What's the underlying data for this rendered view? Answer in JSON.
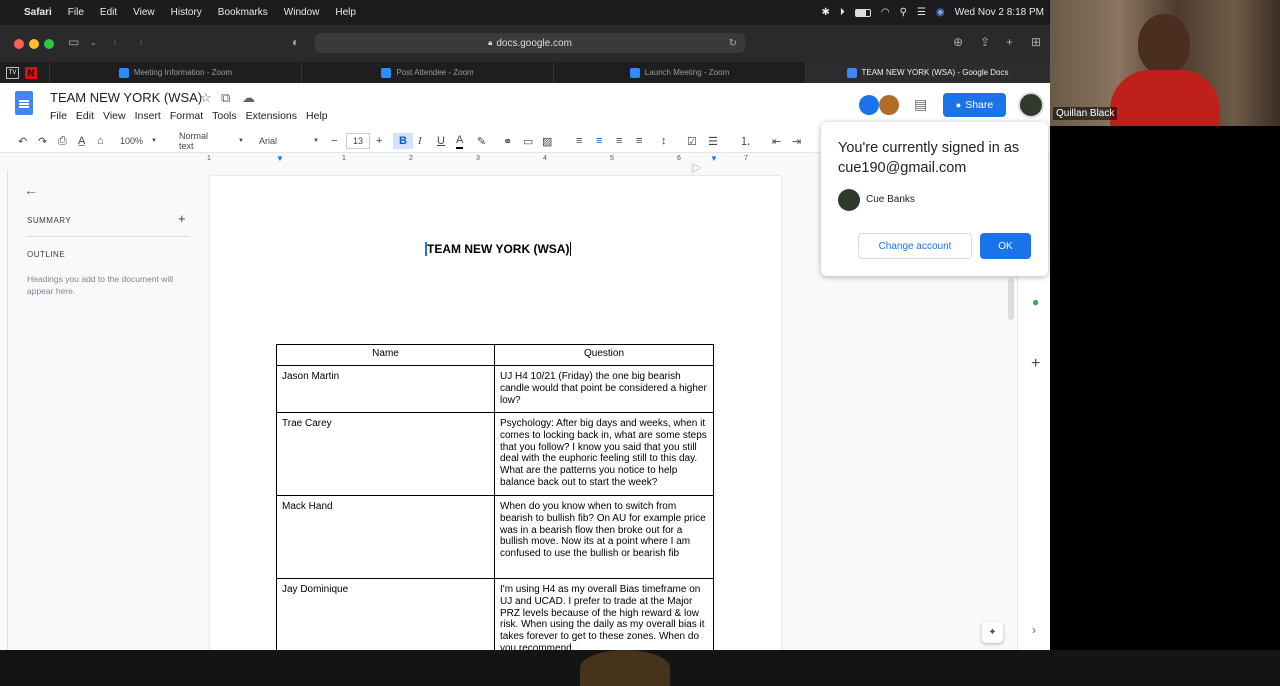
{
  "menubar": {
    "app_name": "Safari",
    "items": [
      "File",
      "Edit",
      "View",
      "History",
      "Bookmarks",
      "Window",
      "Help"
    ],
    "datetime": "Wed Nov 2  8:18 PM"
  },
  "safari": {
    "url": "docs.google.com",
    "tabs": [
      {
        "label": "Meeting Information - Zoom",
        "icon": "zoom-icon"
      },
      {
        "label": "Post Attendee - Zoom",
        "icon": "zoom-icon"
      },
      {
        "label": "Launch Meeting - Zoom",
        "icon": "zoom-icon"
      },
      {
        "label": "TEAM NEW YORK (WSA) - Google Docs",
        "icon": "google-docs-icon"
      }
    ]
  },
  "docs": {
    "title": "TEAM NEW YORK (WSA)",
    "menu": [
      "File",
      "Edit",
      "View",
      "Insert",
      "Format",
      "Tools",
      "Extensions",
      "Help"
    ],
    "share_label": "Share",
    "toolbar": {
      "zoom": "100%",
      "style": "Normal text",
      "font": "Arial",
      "font_size": "13"
    },
    "ruler_numbers": [
      "1",
      "1",
      "2",
      "3",
      "4",
      "5",
      "6",
      "7"
    ],
    "outline": {
      "summary_label": "SUMMARY",
      "outline_label": "OUTLINE",
      "hint": "Headings you add to the document will appear here."
    },
    "page": {
      "heading": "TEAM NEW YORK (WSA)",
      "table": {
        "headers": [
          "Name",
          "Question"
        ],
        "rows": [
          {
            "name": "Jason Martin",
            "question": "UJ H4 10/21 (Friday) the one big bearish candle would that point be considered a higher low?"
          },
          {
            "name": "Trae Carey",
            "question": "Psychology: After big days and weeks, when it comes to locking back in, what are some steps that you follow? I know you said that you still deal with the euphoric feeling still to this day. What are the patterns you notice to help balance back out to start the week?"
          },
          {
            "name": "Mack Hand",
            "question": "When do you know when to switch from bearish to bullish fib? On AU for example price was in a bearish flow then broke out for a bullish move. Now its at a point where I am confused to use the bullish or bearish fib"
          },
          {
            "name": "Jay Dominique",
            "question": "I'm using H4 as my overall Bias timeframe on UJ and UCAD. I prefer to trade at the Major PRZ levels because of the high reward & low risk. When using the daily as my overall bias it takes forever to get to these zones. When do you recommend"
          }
        ]
      }
    },
    "account_popup": {
      "message_line1": "You're currently signed in as",
      "email": "cue190@gmail.com",
      "user_name": "Cue Banks",
      "change_label": "Change account",
      "ok_label": "OK"
    }
  },
  "camera": {
    "participant_name": "Quillan Black"
  }
}
